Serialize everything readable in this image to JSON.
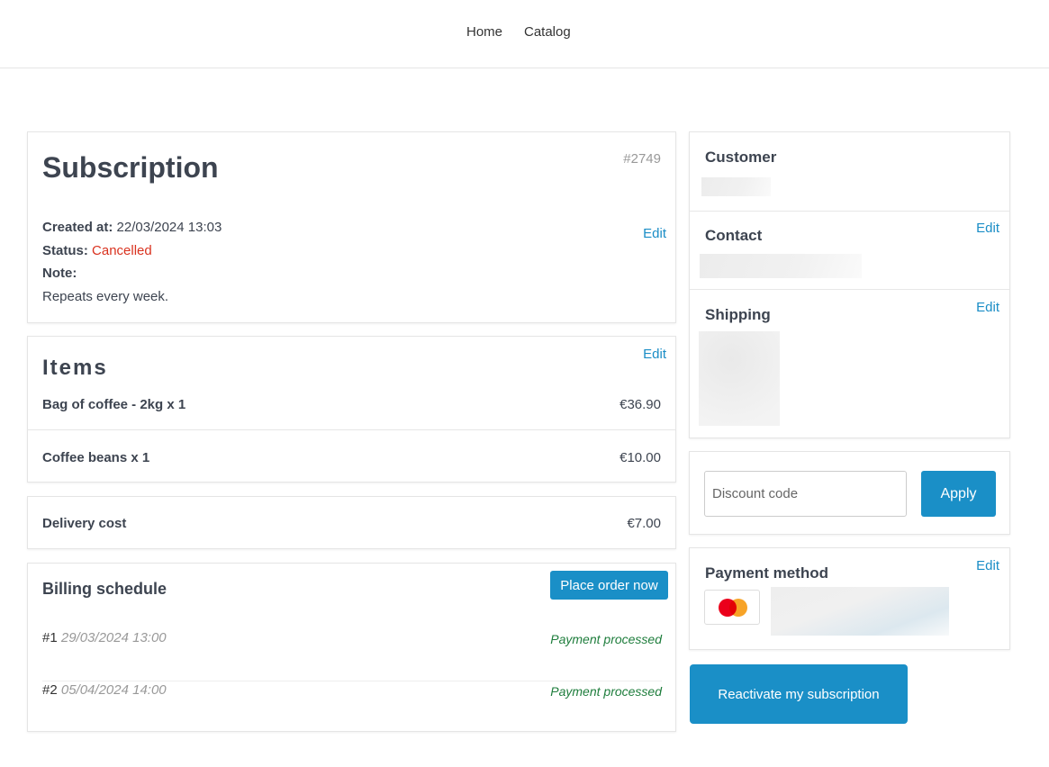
{
  "nav": {
    "home": "Home",
    "catalog": "Catalog"
  },
  "subscription": {
    "title": "Subscription",
    "id": "#2749",
    "created_label": "Created at:",
    "created_value": "22/03/2024 13:03",
    "status_label": "Status:",
    "status_value": "Cancelled",
    "note_label": "Note:",
    "note_value": "Repeats every week.",
    "edit": "Edit"
  },
  "items": {
    "title": "Items",
    "edit": "Edit",
    "rows": [
      {
        "name": "Bag of coffee - 2kg x 1",
        "price": "€36.90"
      },
      {
        "name": "Coffee beans x 1",
        "price": "€10.00"
      }
    ]
  },
  "delivery": {
    "label": "Delivery cost",
    "price": "€7.00"
  },
  "billing": {
    "title": "Billing schedule",
    "place_order": "Place order now",
    "rows": [
      {
        "num": "#1",
        "date": "29/03/2024 13:00",
        "status": "Payment processed"
      },
      {
        "num": "#2",
        "date": "05/04/2024 14:00",
        "status": "Payment processed"
      }
    ]
  },
  "customer": {
    "customer_title": "Customer",
    "contact_title": "Contact",
    "shipping_title": "Shipping",
    "edit": "Edit"
  },
  "discount": {
    "placeholder": "Discount code",
    "value": "",
    "apply": "Apply"
  },
  "payment": {
    "title": "Payment method",
    "edit": "Edit",
    "card_icon": "mastercard-icon"
  },
  "actions": {
    "reactivate": "Reactivate my subscription"
  },
  "colors": {
    "accent": "#1a8fc7",
    "status_cancelled": "#d9321f",
    "payment_processed": "#1e7d3c"
  }
}
